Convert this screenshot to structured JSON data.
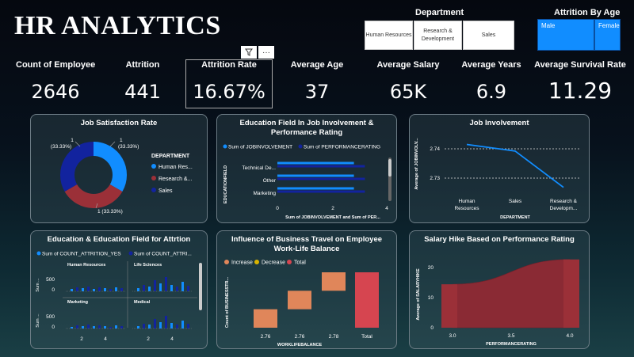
{
  "header": {
    "title": "HR ANALYTICS"
  },
  "slicers": {
    "department": {
      "label": "Department",
      "options": [
        "Human Resources",
        "Research & Development",
        "Sales"
      ]
    },
    "attrition_by_age": {
      "label": "Attrition By Age",
      "options": [
        "Male",
        "Female"
      ]
    }
  },
  "toolbar": {
    "filter_icon": "filter-icon",
    "more_icon": "ellipsis-icon"
  },
  "kpis": [
    {
      "label": "Count of Employee",
      "value": "2646"
    },
    {
      "label": "Attrition",
      "value": "441"
    },
    {
      "label": "Attrition Rate",
      "value": "16.67%"
    },
    {
      "label": "Average Age",
      "value": "37"
    },
    {
      "label": "Average Salary",
      "value": "65K"
    },
    {
      "label": "Average Years",
      "value": "6.9"
    },
    {
      "label": "Average Survival Rate",
      "value": "11.29"
    }
  ],
  "colors": {
    "blue": "#118dff",
    "navy": "#12239e",
    "red": "#9b3038",
    "orange": "#e0865a",
    "yellow": "#d9b300",
    "total": "#d64550"
  },
  "charts": {
    "job_satisfaction": {
      "title": "Job Satisfaction Rate",
      "legend_title": "DEPARTMENT",
      "legend": [
        "Human Res...",
        "Research &...",
        "Sales"
      ],
      "labels": [
        "1\n(33.33%)",
        "1\n(33.33%)",
        "1 (33.33%)"
      ]
    },
    "education_involvement": {
      "title": "Education Field In Job Involvement & Performance Rating",
      "legend": [
        "Sum of JOBINVOLVEMENT",
        "Sum of PERFORMANCERATING"
      ],
      "ylabel": "EDUCATIONFIELD",
      "xlabel": "Sum of JOBINVOLVEMENT and Sum of PER...",
      "xticks": [
        "0",
        "2",
        "4"
      ],
      "categories": [
        "Technical De...",
        "Other",
        "Marketing"
      ]
    },
    "job_involvement": {
      "title": "Job Involvement",
      "ylabel": "Average of JOBINVOLV...",
      "xlabel": "DEPARTMENT",
      "yticks": [
        "2.74",
        "2.73"
      ],
      "categories": [
        "Human Resources",
        "Sales",
        "Research & Developm..."
      ]
    },
    "education_attrition": {
      "title": "Education & Education Field for Attrtion",
      "legend": [
        "Sum of COUNT_ATTRITION_YES",
        "Sum of COUNT_ATTRI..."
      ],
      "panels": [
        "Human Resources",
        "Life Sciences",
        "Marketing",
        "Medical"
      ],
      "ylabel": "Sum ...",
      "yticks": [
        "500",
        "0"
      ],
      "xticks": [
        "2",
        "4"
      ]
    },
    "business_travel": {
      "title": "Influence of Business Travel on Employee Work-Life Balance",
      "legend": [
        "Increase",
        "Decrease",
        "Total"
      ],
      "ylabel": "Count of BUSINESSTR...",
      "xlabel": "WORKLIFEBALANCE",
      "categories": [
        "2.76",
        "2.76",
        "2.78",
        "Total"
      ]
    },
    "salary_hike": {
      "title": "Salary Hike Based on Performance Rating",
      "ylabel": "Average of SALARYHIKE",
      "xlabel": "PERFORMANCERATING",
      "yticks": [
        "20",
        "10",
        "0"
      ],
      "xticks": [
        "3.0",
        "3.5",
        "4.0"
      ]
    }
  },
  "chart_data": [
    {
      "type": "pie",
      "title": "Job Satisfaction Rate",
      "categories": [
        "Human Resources",
        "Research & Development",
        "Sales"
      ],
      "values": [
        1,
        1,
        1
      ],
      "percent": [
        33.33,
        33.33,
        33.33
      ]
    },
    {
      "type": "bar",
      "title": "Education Field In Job Involvement & Performance Rating",
      "categories": [
        "Technical De...",
        "Other",
        "Marketing"
      ],
      "series": [
        {
          "name": "Sum of JOBINVOLVEMENT",
          "values": [
            2.8,
            2.8,
            2.8
          ]
        },
        {
          "name": "Sum of PERFORMANCERATING",
          "values": [
            3.2,
            3.2,
            3.2
          ]
        }
      ],
      "xlim": [
        0,
        4
      ]
    },
    {
      "type": "line",
      "title": "Job Involvement",
      "categories": [
        "Human Resources",
        "Sales",
        "Research & Development"
      ],
      "values": [
        2.742,
        2.74,
        2.729
      ],
      "ylim": [
        2.727,
        2.745
      ]
    },
    {
      "type": "area",
      "title": "Salary Hike Based on Performance Rating",
      "x": [
        3.0,
        4.0
      ],
      "values": [
        14,
        22
      ],
      "ylim": [
        0,
        25
      ]
    },
    {
      "type": "bar",
      "title": "Influence of Business Travel on Employee Work-Life Balance",
      "categories": [
        "2.76",
        "2.76",
        "2.78",
        "Total"
      ],
      "values": [
        200,
        200,
        200,
        600
      ]
    }
  ]
}
